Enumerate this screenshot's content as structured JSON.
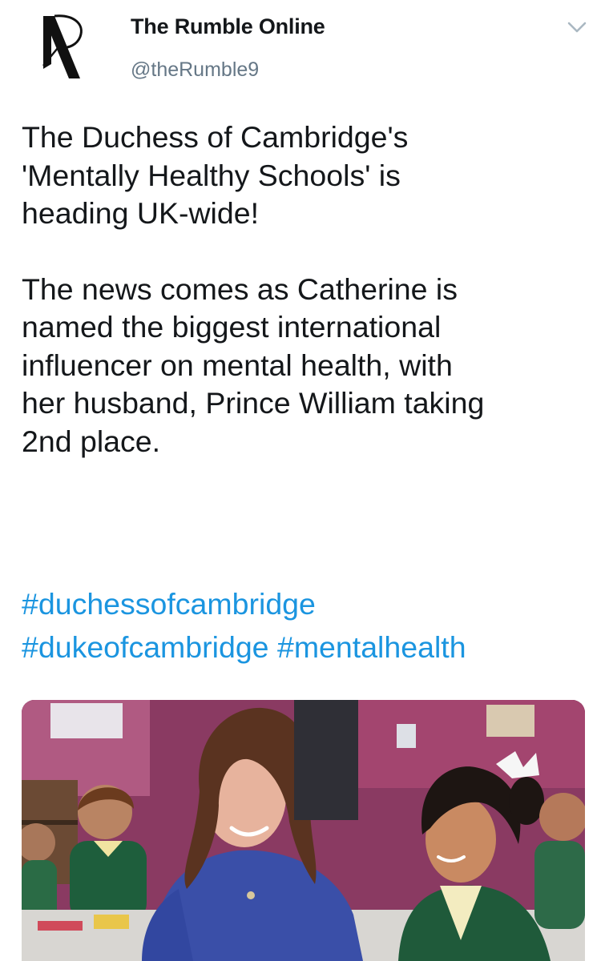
{
  "tweet": {
    "author": {
      "display_name": "The Rumble Online",
      "handle": "@theRumble9",
      "avatar_icon": "rumble-logo-icon"
    },
    "menu_icon": "chevron-down-icon",
    "paragraphs": [
      "The Duchess of Cambridge's\n'Mentally Healthy Schools' is\nheading UK-wide!",
      "The news comes as Catherine is\nnamed the biggest international\ninfluencer on mental health, with\nher husband, Prince William taking\n2nd place."
    ],
    "hashtags": [
      "#duchessofcambridge",
      "#dukeofcambridge",
      "#mentalhealth"
    ],
    "colors": {
      "link": "#1b95e0",
      "text": "#14171a",
      "secondary": "#657786"
    }
  }
}
